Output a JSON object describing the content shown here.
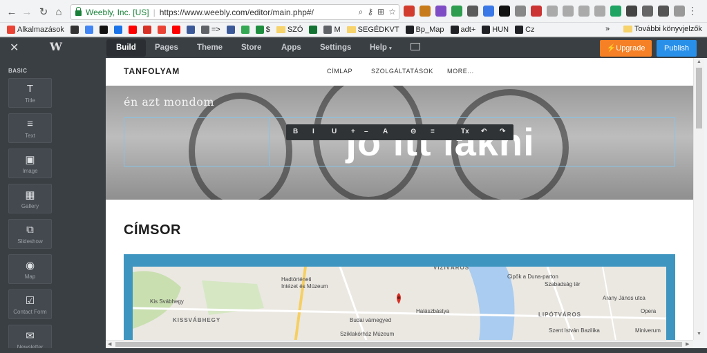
{
  "browser": {
    "secure_label": "Weebly, Inc. [US]",
    "url": "https://www.weebly.com/editor/main.php#/",
    "extension_colors": [
      "#d23c2e",
      "#c77b1b",
      "#7e4cc4",
      "#2e9d4f",
      "#5b5b5b",
      "#3b78e7",
      "#111111",
      "#888888",
      "#cc3333",
      "#aaaaaa",
      "#aaaaaa",
      "#aaaaaa",
      "#aaaaaa",
      "#1fa463",
      "#444444",
      "#666666",
      "#555555",
      "#999999"
    ]
  },
  "bookmarks": {
    "items": [
      {
        "label": "Alkalmazások",
        "color": "#ea4335"
      },
      {
        "label": "",
        "color": "#333333"
      },
      {
        "label": "",
        "color": "#4285f4"
      },
      {
        "label": "",
        "color": "#111111"
      },
      {
        "label": "",
        "color": "#1a73e8"
      },
      {
        "label": "",
        "color": "#ff0000"
      },
      {
        "label": "",
        "color": "#d93025"
      },
      {
        "label": "",
        "color": "#ea4335"
      },
      {
        "label": "",
        "color": "#ff0000"
      },
      {
        "label": "",
        "color": "#3b5998"
      },
      {
        "label": "=>",
        "color": "#5f6368"
      },
      {
        "label": "",
        "color": "#3b5998"
      },
      {
        "label": "",
        "color": "#34a853"
      },
      {
        "label": "$",
        "color": "#1e8e3e"
      },
      {
        "label": "SZÓ",
        "color": "#f6d36b"
      },
      {
        "label": "",
        "color": "#137333"
      },
      {
        "label": "M",
        "color": "#5f6368"
      },
      {
        "label": "SEGÉDKVT",
        "color": "#f6d36b"
      },
      {
        "label": "Bp_Map",
        "color": "#202124"
      },
      {
        "label": "adt+",
        "color": "#202124"
      },
      {
        "label": "HUN",
        "color": "#202124"
      },
      {
        "label": "Cz",
        "color": "#202124"
      }
    ],
    "more_label": "»",
    "other_folder": "További könyvjelzők"
  },
  "editor": {
    "tabs": [
      "Build",
      "Pages",
      "Theme",
      "Store",
      "Apps",
      "Settings",
      "Help"
    ],
    "upgrade_label": "Upgrade",
    "publish_label": "Publish"
  },
  "sidebar": {
    "section": "BASIC",
    "items": [
      {
        "label": "Title",
        "icon": "T"
      },
      {
        "label": "Text",
        "icon": "≡"
      },
      {
        "label": "Image",
        "icon": "▣"
      },
      {
        "label": "Gallery",
        "icon": "▦"
      },
      {
        "label": "Slideshow",
        "icon": "⧉"
      },
      {
        "label": "Map",
        "icon": "◉"
      },
      {
        "label": "Contact Form",
        "icon": "☑"
      },
      {
        "label": "Newsletter",
        "icon": "✉"
      }
    ]
  },
  "site": {
    "title": "TANFOLYAM",
    "nav": [
      "CÍMLAP",
      "SZOLGÁLTATÁSOK",
      "MORE..."
    ],
    "hero_sub": "én azt mondom",
    "hero_title": "jó itt lakni",
    "heading": "CÍMSOR"
  },
  "rte_toolbar": [
    "B",
    "I",
    "U",
    "+",
    "–",
    "A",
    "⊝",
    "≡",
    "Tx",
    "↶",
    "↷"
  ],
  "map": {
    "labels": [
      "VÍZIVÁROS",
      "Hadtörténeti",
      "Intézet és Múzeum",
      "Kis Svábhegy",
      "KISSVÁBHEGY",
      "Budai várnegyed",
      "Halászbástya",
      "Sziklakórház Múzeum",
      "Cipők a Duna-parton",
      "Szabadság tér",
      "LIPÓTVÁROS",
      "Szent István Bazilika",
      "Arany János utca",
      "Opera",
      "Miniverum"
    ]
  }
}
